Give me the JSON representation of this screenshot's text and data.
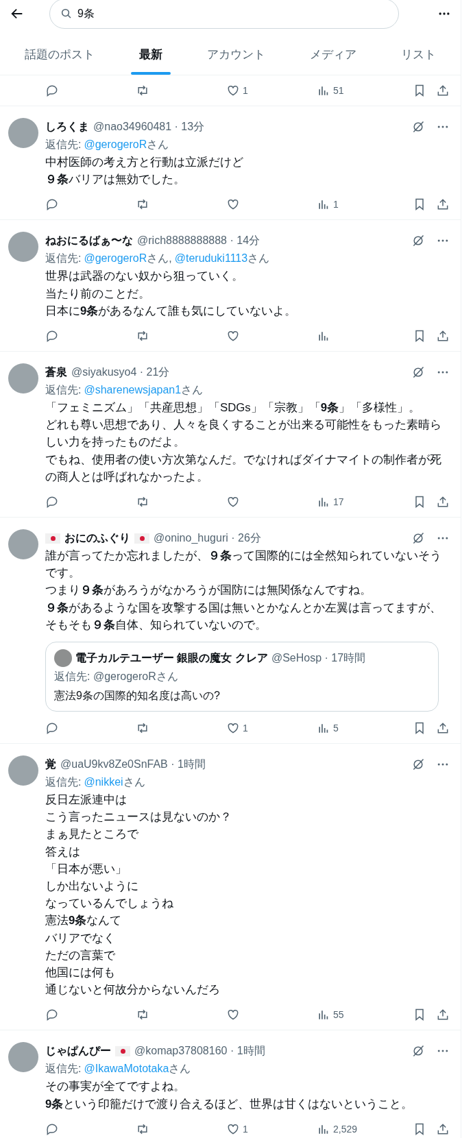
{
  "search": {
    "value": "9条"
  },
  "tabs": [
    {
      "label": "話題のポスト",
      "selected": false
    },
    {
      "label": "最新",
      "selected": true
    },
    {
      "label": "アカウント",
      "selected": false
    },
    {
      "label": "メディア",
      "selected": false
    },
    {
      "label": "リスト",
      "selected": false
    }
  ],
  "top_actions": {
    "likes": "1",
    "views": "51"
  },
  "posts": [
    {
      "name": "しろくま",
      "meta": "@nao34960481 · 13分",
      "reply_label": "返信先:",
      "reply_to": [
        {
          "mention": "@gerogeroR",
          "suffix": "さん"
        }
      ],
      "body": [
        "中村医師の考え方と行動は立派だけど",
        "**９条**バリアは無効でした。"
      ],
      "actions": {
        "views": "1"
      }
    },
    {
      "name": "ねおにるばぁ〜な",
      "meta": "@rich8888888888 · 14分",
      "reply_label": "返信先:",
      "reply_to": [
        {
          "mention": "@gerogeroR",
          "suffix": "さん,"
        },
        {
          "mention": "@teruduki1113",
          "suffix": "さん"
        }
      ],
      "body": [
        "世界は武器のない奴から狙っていく。",
        "当たり前のことだ。",
        "日本に**9条**があるなんて誰も気にしていないよ。"
      ]
    },
    {
      "name": "蒼泉",
      "meta": "@siyakusyo4 · 21分",
      "reply_label": "返信先:",
      "reply_to": [
        {
          "mention": "@sharenewsjapan1",
          "suffix": "さん"
        }
      ],
      "body": [
        "「フェミニズム」「共産思想」「SDGs」「宗教」「**9条**」「多様性」。",
        "どれも尊い思想であり、人々を良くすることが出来る可能性をもった素晴らしい力を持ったものだよ。",
        "でもね、使用者の使い方次第なんだ。でなければダイナマイトの制作者が死の商人とは呼ばれなかったよ。"
      ],
      "actions": {
        "views": "17"
      }
    },
    {
      "name": "おにのふぐり",
      "flag_before": true,
      "flag_after": true,
      "meta": "@onino_huguri · 26分",
      "body": [
        "誰が言ってたか忘れましたが、**９条**って国際的には全然知られていないそうです。",
        "つまり**９条**があろうがなかろうが国防には無関係なんですね。",
        "**９条**があるような国を攻撃する国は無いとかなんとか左翼は言ってますが、そもそも**９条**自体、知られていないので。"
      ],
      "quote": {
        "name": "電子カルテユーザー 銀眼の魔女 クレア",
        "meta": "@SeHosp · 17時間",
        "reply": "返信先: @gerogeroRさん",
        "text": "憲法9条の国際的知名度は高いの?"
      },
      "actions": {
        "likes": "1",
        "views": "5"
      }
    },
    {
      "name": "覚",
      "meta": "@uaU9kv8Ze0SnFAB · 1時間",
      "reply_label": "返信先:",
      "reply_to": [
        {
          "mention": "@nikkei",
          "suffix": "さん"
        }
      ],
      "body": [
        "反日左派連中は",
        "こう言ったニュースは見ないのか？",
        "まぁ見たところで",
        "答えは",
        "「日本が悪い」",
        "しか出ないように",
        "なっているんでしょうね",
        "憲法**9条**なんて",
        "バリアでなく",
        "ただの言葉で",
        "他国には何も",
        "通じないと何故分からないんだろ"
      ],
      "actions": {
        "views": "55"
      }
    },
    {
      "name": "じゃぱんぴー",
      "flag_after": true,
      "meta": "@komap37808160 · 1時間",
      "reply_label": "返信先:",
      "reply_to": [
        {
          "mention": "@IkawaMototaka",
          "suffix": "さん"
        }
      ],
      "body": [
        "その事実が全てですよね。",
        "**9条**という印籠だけで渡り合えるほど、世界は甘くはないということ。"
      ],
      "actions": {
        "likes": "1",
        "views": "2,529"
      }
    }
  ]
}
